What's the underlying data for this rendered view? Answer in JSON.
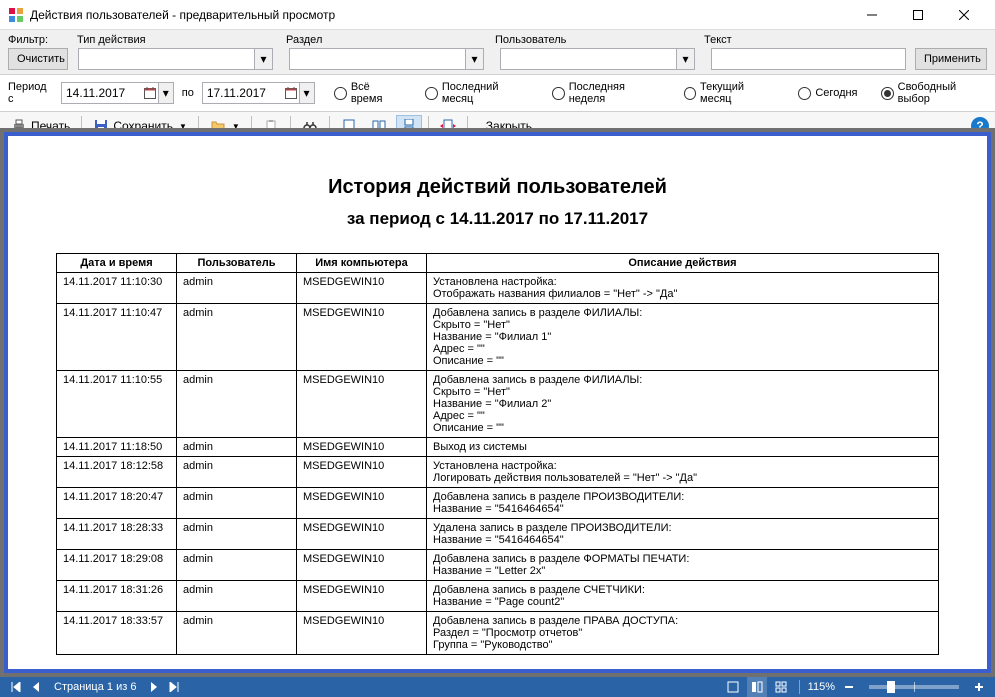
{
  "window": {
    "title": "Действия пользователей - предварительный просмотр"
  },
  "filter": {
    "filter_label": "Фильтр:",
    "type_label": "Тип действия",
    "section_label": "Раздел",
    "user_label": "Пользователь",
    "text_label": "Текст",
    "clear_btn": "Очистить",
    "apply_btn": "Применить",
    "type_value": "",
    "section_value": "",
    "user_value": "",
    "text_value": ""
  },
  "period": {
    "label_from": "Период с",
    "label_to": "по",
    "date_from": "14.11.2017",
    "date_to": "17.11.2017",
    "radio_all": "Всё время",
    "radio_last_month": "Последний месяц",
    "radio_last_week": "Последняя неделя",
    "radio_current_month": "Текущий месяц",
    "radio_today": "Сегодня",
    "radio_custom": "Свободный выбор",
    "selected": "custom"
  },
  "toolbar": {
    "print": "Печать",
    "save": "Сохранить",
    "close": "Закрыть"
  },
  "report": {
    "title": "История действий пользователей",
    "subtitle": "за период с 14.11.2017 по 17.11.2017",
    "headers": {
      "datetime": "Дата и время",
      "user": "Пользователь",
      "computer": "Имя компьютера",
      "description": "Описание действия"
    },
    "rows": [
      {
        "dt": "14.11.2017 11:10:30",
        "user": "admin",
        "comp": "MSEDGEWIN10",
        "desc": [
          "Установлена настройка:",
          "Отображать названия филиалов = \"Нет\" -> \"Да\""
        ]
      },
      {
        "dt": "14.11.2017 11:10:47",
        "user": "admin",
        "comp": "MSEDGEWIN10",
        "desc": [
          "Добавлена запись в разделе ФИЛИАЛЫ:",
          "Скрыто = \"Нет\"",
          "Название = \"Филиал 1\"",
          "Адрес = \"\"",
          "Описание = \"\""
        ]
      },
      {
        "dt": "14.11.2017 11:10:55",
        "user": "admin",
        "comp": "MSEDGEWIN10",
        "desc": [
          "Добавлена запись в разделе ФИЛИАЛЫ:",
          "Скрыто = \"Нет\"",
          "Название = \"Филиал 2\"",
          "Адрес = \"\"",
          "Описание = \"\""
        ]
      },
      {
        "dt": "14.11.2017 11:18:50",
        "user": "admin",
        "comp": "MSEDGEWIN10",
        "desc": [
          "Выход из системы"
        ]
      },
      {
        "dt": "14.11.2017 18:12:58",
        "user": "admin",
        "comp": "MSEDGEWIN10",
        "desc": [
          "Установлена настройка:",
          "Логировать действия пользователей = \"Нет\" -> \"Да\""
        ]
      },
      {
        "dt": "14.11.2017 18:20:47",
        "user": "admin",
        "comp": "MSEDGEWIN10",
        "desc": [
          "Добавлена запись в разделе ПРОИЗВОДИТЕЛИ:",
          "Название = \"5416464654\""
        ]
      },
      {
        "dt": "14.11.2017 18:28:33",
        "user": "admin",
        "comp": "MSEDGEWIN10",
        "desc": [
          "Удалена запись в разделе ПРОИЗВОДИТЕЛИ:",
          "Название = \"5416464654\""
        ]
      },
      {
        "dt": "14.11.2017 18:29:08",
        "user": "admin",
        "comp": "MSEDGEWIN10",
        "desc": [
          "Добавлена запись в разделе ФОРМАТЫ ПЕЧАТИ:",
          "Название = \"Letter 2x\""
        ]
      },
      {
        "dt": "14.11.2017 18:31:26",
        "user": "admin",
        "comp": "MSEDGEWIN10",
        "desc": [
          "Добавлена запись в разделе СЧЕТЧИКИ:",
          "Название = \"Page count2\""
        ]
      },
      {
        "dt": "14.11.2017 18:33:57",
        "user": "admin",
        "comp": "MSEDGEWIN10",
        "desc": [
          "Добавлена запись в разделе ПРАВА ДОСТУПА:",
          "Раздел = \"Просмотр отчетов\"",
          "Группа = \"Руководство\""
        ]
      }
    ]
  },
  "statusbar": {
    "page_text": "Страница 1 из 6",
    "zoom_text": "115%"
  }
}
